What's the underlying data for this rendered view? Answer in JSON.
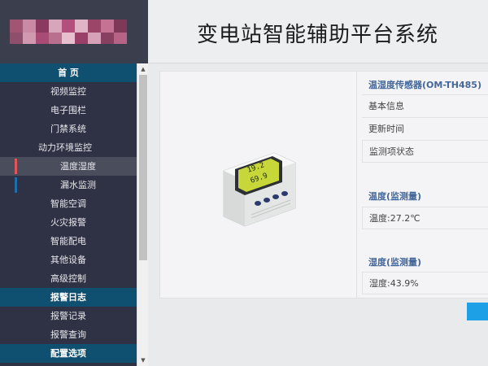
{
  "header": {
    "title": "变电站智能辅助平台系统"
  },
  "logo": {
    "colors": [
      "#a83f66",
      "#c77497",
      "#8a3a5f",
      "#d6a2b8",
      "#b65380",
      "#6e3550"
    ]
  },
  "sidebar": {
    "items": [
      {
        "label": "首 页",
        "kind": "section"
      },
      {
        "label": "视频监控",
        "kind": "item"
      },
      {
        "label": "电子围栏",
        "kind": "item"
      },
      {
        "label": "门禁系统",
        "kind": "item"
      },
      {
        "label": "动力环境监控",
        "kind": "parent"
      },
      {
        "label": "温度湿度",
        "kind": "sub",
        "active": true,
        "mark_color": "#e2555a"
      },
      {
        "label": "漏水监测",
        "kind": "sub",
        "active": false,
        "mark_color": "#1f6ea8"
      },
      {
        "label": "智能空调",
        "kind": "item"
      },
      {
        "label": "火灾报警",
        "kind": "item"
      },
      {
        "label": "智能配电",
        "kind": "item"
      },
      {
        "label": "其他设备",
        "kind": "item"
      },
      {
        "label": "高级控制",
        "kind": "item"
      },
      {
        "label": "报警日志",
        "kind": "section"
      },
      {
        "label": "报警记录",
        "kind": "item"
      },
      {
        "label": "报警查询",
        "kind": "item"
      },
      {
        "label": "配置选项",
        "kind": "section"
      }
    ]
  },
  "device": {
    "display_line1": "19.2",
    "display_line2": "69.9"
  },
  "sensor": {
    "title": "温湿度传感器(OM-TH485)",
    "rows": [
      "基本信息",
      "更新时间",
      "监测项状态"
    ],
    "temp_head": "温度(监测量)",
    "temp_value": "温度:27.2℃",
    "hum_head": "湿度(监测量)",
    "hum_value": "湿度:43.9%"
  },
  "colors": {
    "section_bg": "#0f4f70",
    "sidebar_bg": "#2f3244",
    "accent": "#1ea0e6"
  }
}
